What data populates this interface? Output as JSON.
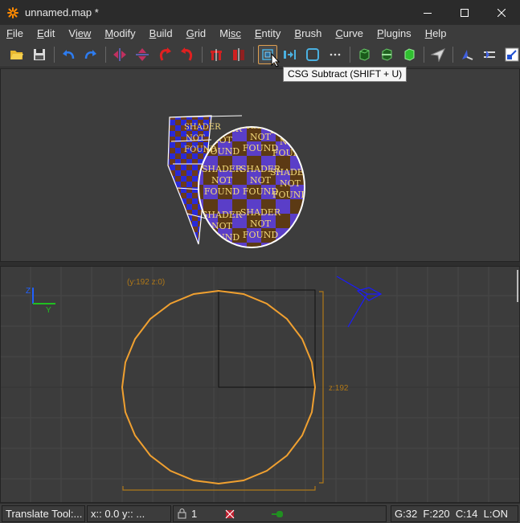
{
  "window": {
    "title": "unnamed.map *",
    "app_icon": "radiant-asterisk-icon",
    "buttons": [
      "minimize-icon",
      "maximize-icon",
      "close-icon"
    ]
  },
  "menu": [
    {
      "label": "File",
      "key": "F",
      "rest": "ile"
    },
    {
      "label": "Edit",
      "key": "E",
      "rest": "dit"
    },
    {
      "label": "View",
      "key": "V",
      "rest": "iew"
    },
    {
      "label": "Modify",
      "key": "M",
      "rest": "odify"
    },
    {
      "label": "Build",
      "key": "B",
      "rest": "uild"
    },
    {
      "label": "Grid",
      "key": "G",
      "rest": "rid"
    },
    {
      "label": "Misc",
      "key": "M",
      "rest": "isc"
    },
    {
      "label": "Entity",
      "key": "E",
      "rest": "ntity"
    },
    {
      "label": "Brush",
      "key": "B",
      "rest": "rush"
    },
    {
      "label": "Curve",
      "key": "C",
      "rest": "urve"
    },
    {
      "label": "Plugins",
      "key": "P",
      "rest": "lugins"
    },
    {
      "label": "Help",
      "key": "H",
      "rest": "elp"
    }
  ],
  "toolbar": {
    "buttons": [
      "open-folder-icon",
      "save-icon",
      "undo-icon",
      "redo-icon",
      "flip-x-icon",
      "flip-y-icon",
      "rotate-x-icon",
      "rotate-y-icon",
      "clipper-icon",
      "hollow-icon",
      "csg-subtract-icon",
      "csg-merge-icon",
      "make-room-icon",
      "more-icon",
      "texture-lock-icon",
      "cube-clip-icon",
      "select-green-icon",
      "camera-mode-icon",
      "entity-icon",
      "patch-icon",
      "scale-icon"
    ],
    "active": "csg-subtract-icon"
  },
  "tooltip": {
    "text": "CSG Subtract (SHIFT + U)"
  },
  "viewport3d": {
    "shader_text": [
      "SHADER",
      "NOT",
      "FOUND"
    ],
    "colors": {
      "checker_a": "#5a3ec8",
      "checker_b": "#5c3a14",
      "text": "#f2d97a",
      "outline": "#ffffff"
    }
  },
  "viewport2d": {
    "axis_labels": {
      "z": "Z",
      "y": "Y"
    },
    "size_top": "(y:192  z:0)",
    "size_right": "z:192",
    "colors": {
      "brush": "#f0a030",
      "axis_z": "#2060ff",
      "axis_y": "#20c020",
      "camera": "#1a1aff"
    }
  },
  "status": {
    "tool": "Translate Tool:...",
    "coords": "x::    0.0  y::   ...",
    "selection_count": "1",
    "grid": "G:32",
    "faces": "F:220",
    "count_c": "C:14",
    "lock": "L:ON"
  }
}
